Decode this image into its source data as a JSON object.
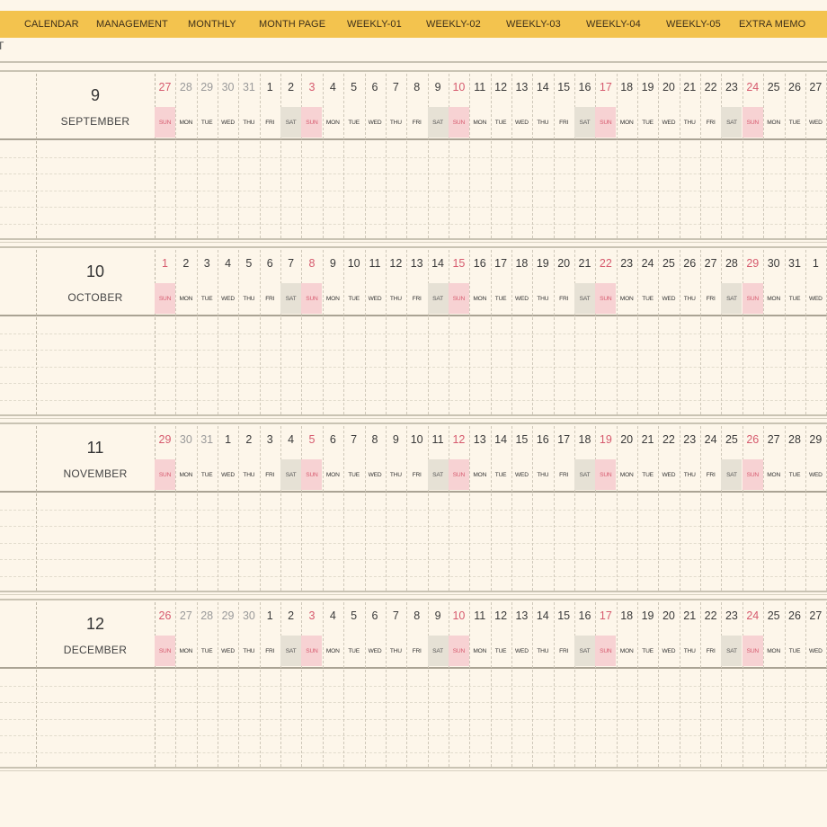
{
  "nav": {
    "items": [
      "CALENDAR",
      "MANAGEMENT",
      "MONTHLY",
      "MONTH PAGE",
      "WEEKLY-01",
      "WEEKLY-02",
      "WEEKLY-03",
      "WEEKLY-04",
      "WEEKLY-05",
      "EXTRA MEMO"
    ]
  },
  "left_edge_glyph": "T",
  "weekday_labels": [
    "SUN",
    "MON",
    "TUE",
    "WED",
    "THU",
    "FRI",
    "SAT"
  ],
  "colors": {
    "nav_bg": "#f3c34e",
    "page_bg": "#fdf6ea",
    "sunday": "#d65a6e",
    "sunday_bg": "#f7d2d3",
    "saturday_bg": "#e6e1d5"
  },
  "months": [
    {
      "number": "9",
      "name": "SEPTEMBER",
      "days": [
        "27",
        "28",
        "29",
        "30",
        "31",
        "1",
        "2",
        "3",
        "4",
        "5",
        "6",
        "7",
        "8",
        "9",
        "10",
        "11",
        "12",
        "13",
        "14",
        "15",
        "16",
        "17",
        "18",
        "19",
        "20",
        "21",
        "22",
        "23",
        "24",
        "25",
        "26",
        "27"
      ],
      "first_current_index": 5
    },
    {
      "number": "10",
      "name": "OCTOBER",
      "days": [
        "1",
        "2",
        "3",
        "4",
        "5",
        "6",
        "7",
        "8",
        "9",
        "10",
        "11",
        "12",
        "13",
        "14",
        "15",
        "16",
        "17",
        "18",
        "19",
        "20",
        "21",
        "22",
        "23",
        "24",
        "25",
        "26",
        "27",
        "28",
        "29",
        "30",
        "31",
        "1"
      ],
      "first_current_index": 0
    },
    {
      "number": "11",
      "name": "NOVEMBER",
      "days": [
        "29",
        "30",
        "31",
        "1",
        "2",
        "3",
        "4",
        "5",
        "6",
        "7",
        "8",
        "9",
        "10",
        "11",
        "12",
        "13",
        "14",
        "15",
        "16",
        "17",
        "18",
        "19",
        "20",
        "21",
        "22",
        "23",
        "24",
        "25",
        "26",
        "27",
        "28",
        "29"
      ],
      "first_current_index": 3
    },
    {
      "number": "12",
      "name": "DECEMBER",
      "days": [
        "26",
        "27",
        "28",
        "29",
        "30",
        "1",
        "2",
        "3",
        "4",
        "5",
        "6",
        "7",
        "8",
        "9",
        "10",
        "11",
        "12",
        "13",
        "14",
        "15",
        "16",
        "17",
        "18",
        "19",
        "20",
        "21",
        "22",
        "23",
        "24",
        "25",
        "26",
        "27"
      ],
      "first_current_index": 5
    }
  ]
}
